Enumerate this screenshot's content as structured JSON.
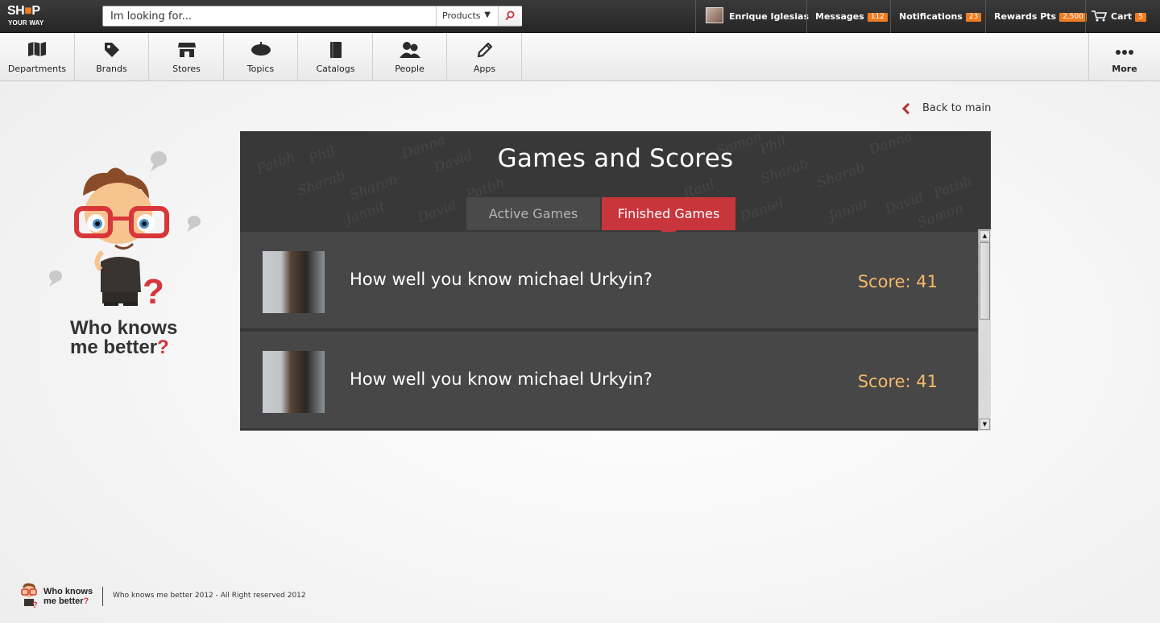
{
  "topbar": {
    "logo": {
      "line1_a": "SH",
      "line1_b": "P",
      "line2": "YOUR WAY"
    },
    "search": {
      "placeholder": "Im looking for...",
      "category": "Products"
    },
    "user": {
      "name": "Enrique Iglesias"
    },
    "messages": {
      "label": "Messages",
      "count": "112"
    },
    "notifications": {
      "label": "Notifications",
      "count": "23"
    },
    "rewards": {
      "label": "Rewards Pts",
      "count": "2,500"
    },
    "cart": {
      "label": "Cart",
      "count": "5"
    },
    "badge_color": "#f07c21"
  },
  "nav": {
    "items": [
      {
        "label": "Departments",
        "icon": "map-icon"
      },
      {
        "label": "Brands",
        "icon": "tag-icon"
      },
      {
        "label": "Stores",
        "icon": "store-icon"
      },
      {
        "label": "Topics",
        "icon": "beret-icon"
      },
      {
        "label": "Catalogs",
        "icon": "catalog-icon"
      },
      {
        "label": "People",
        "icon": "people-icon"
      },
      {
        "label": "Apps",
        "icon": "pencil-icon"
      }
    ],
    "more": {
      "label": "More",
      "icon": "ellipsis-icon"
    }
  },
  "brand": {
    "line1": "Who knows",
    "line2": "me better",
    "q": "?"
  },
  "back_link": {
    "label": "Back to main"
  },
  "panel": {
    "title": "Games and Scores",
    "tabs": [
      {
        "label": "Active Games",
        "active": false
      },
      {
        "label": "Finished Games",
        "active": true
      }
    ],
    "watermark_names": [
      "Patbh",
      "Phil",
      "Danna",
      "David",
      "Sharab",
      "Sharab",
      "Patbh",
      "Raul",
      "Jannit",
      "David",
      "Daniel",
      "Samon",
      "Sharab",
      "Jannit",
      "David",
      "Patbh",
      "Samon",
      "Danna",
      "Phil",
      "Sharab"
    ],
    "games": [
      {
        "question": "How well you know michael Urkyin?",
        "score": "Score: 41"
      },
      {
        "question": "How well you know michael Urkyin?",
        "score": "Score: 41"
      }
    ],
    "accent_color": "#c8363b",
    "score_color": "#f3b86a"
  },
  "footer": {
    "brand_line1": "Who knows",
    "brand_line2": "me better",
    "brand_q": "?",
    "copyright": "Who knows me better 2012 - All Right reserved 2012"
  }
}
